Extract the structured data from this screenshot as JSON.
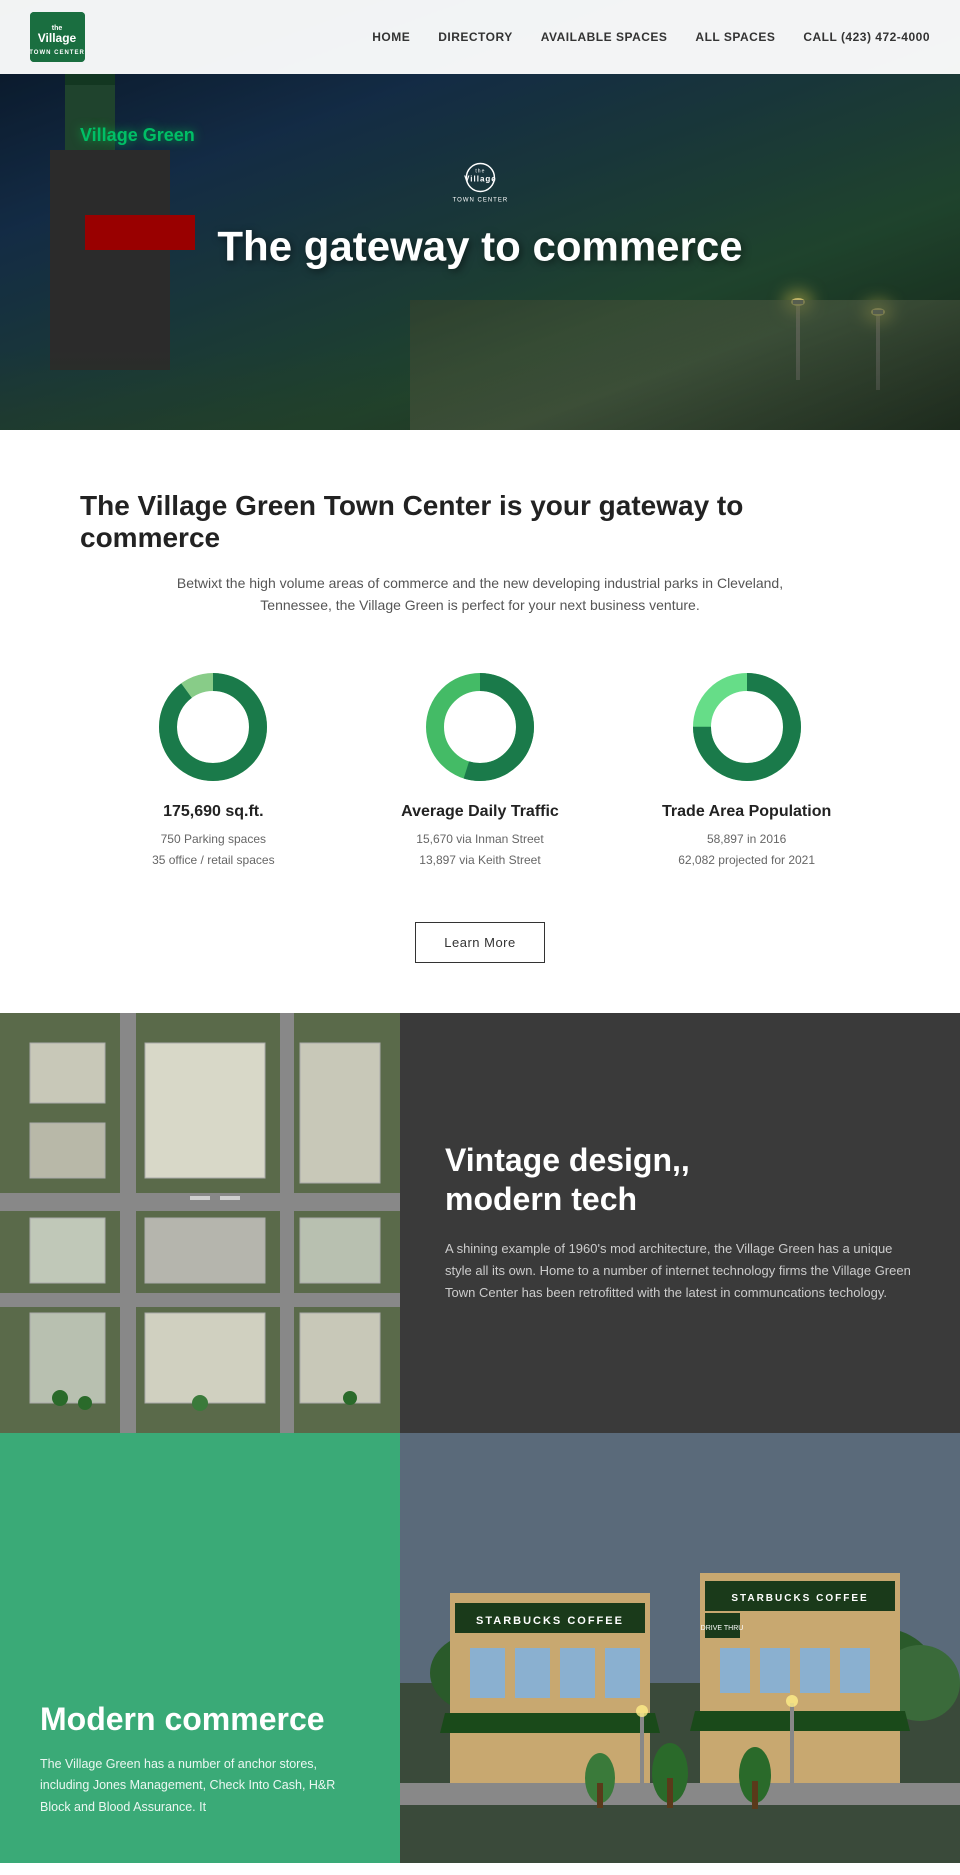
{
  "nav": {
    "logo_text": "the\nVillage\nTOWN CENTER",
    "links": [
      {
        "label": "HOME",
        "href": "#"
      },
      {
        "label": "DiRectory",
        "href": "#"
      },
      {
        "label": "AVAILABLE SPACES",
        "href": "#"
      },
      {
        "label": "ALL SPACES",
        "href": "#"
      },
      {
        "label": "CALL (423) 472-4000",
        "href": "#"
      }
    ]
  },
  "hero": {
    "small_logo": "the Village TOWN CENTER",
    "title": "The gateway to commerce"
  },
  "stats": {
    "headline": "The Village Green Town Center is your gateway to commerce",
    "subtext": "Betwixt the high volume areas of commerce and the new developing industrial parks in Cleveland,\nTennessee, the Village Green is perfect for your next business venture.",
    "items": [
      {
        "id": "sqft",
        "value": "175,690 sq.ft.",
        "details": [
          "750 Parking spaces",
          "35 office / retail spaces"
        ],
        "chart_primary": "#1a7a4a",
        "chart_secondary": "#88cc88",
        "primary_pct": 90
      },
      {
        "id": "traffic",
        "value": "Average Daily Traffic",
        "details": [
          "15,670 via Inman Street",
          "13,897 via Keith Street"
        ],
        "chart_primary": "#44bb66",
        "chart_secondary": "#1a7a4a",
        "primary_pct": 55
      },
      {
        "id": "population",
        "value": "Trade Area Population",
        "details": [
          "58,897 in 2016",
          "62,082 projected for 2021"
        ],
        "chart_primary": "#66dd88",
        "chart_secondary": "#1a7a4a",
        "primary_pct": 75
      }
    ],
    "learn_more": "Learn More"
  },
  "vintage": {
    "title": "Vintage design,\nmodern tech",
    "text": "A shining example of 1960's mod architecture, the Village Green has a unique style all its own. Home to a number of internet technology firms the Village Green Town Center has been retrofitted with the latest in communcations techology."
  },
  "modern": {
    "title": "Modern commerce",
    "text": "The Village Green has a number of anchor stores, including Jones Management, Check Into Cash, H&R Block and Blood Assurance. It"
  }
}
